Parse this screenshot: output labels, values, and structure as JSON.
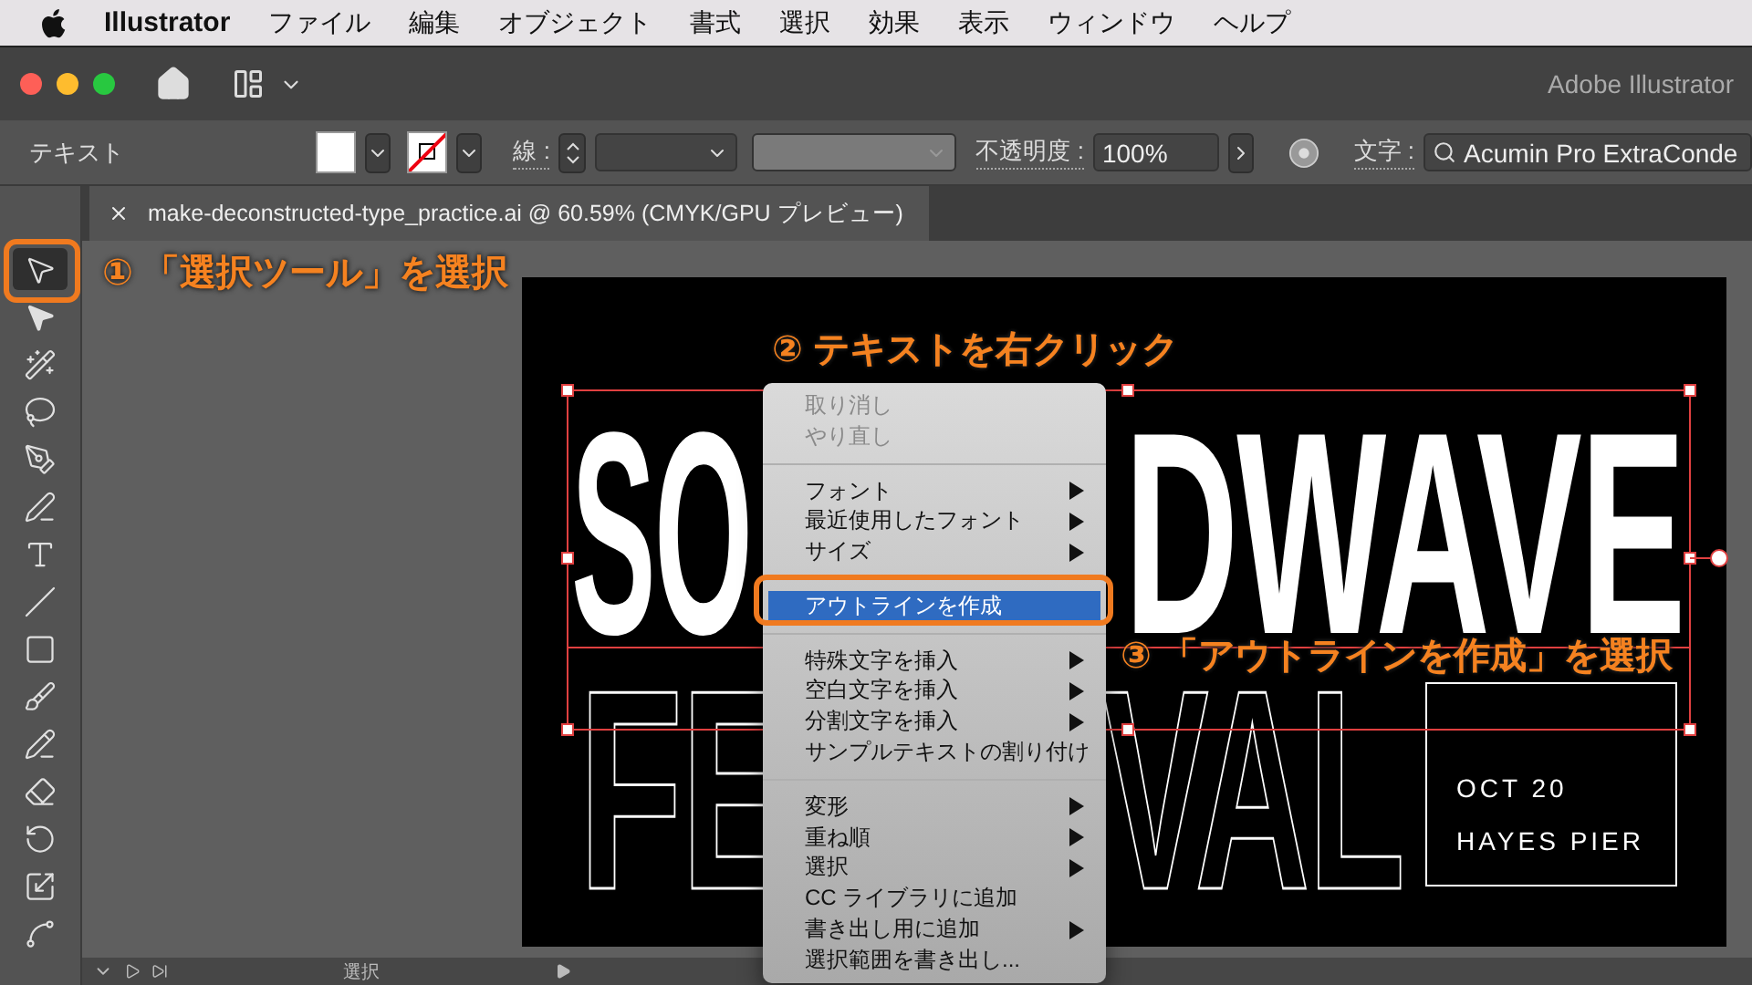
{
  "menu_bar": {
    "app": "Illustrator",
    "items": [
      "ファイル",
      "編集",
      "オブジェクト",
      "書式",
      "選択",
      "効果",
      "表示",
      "ウィンドウ",
      "ヘルプ"
    ]
  },
  "title_bar": {
    "title": "Adobe Illustrator"
  },
  "control_bar": {
    "selection_label": "テキスト",
    "stroke_label": "線 :",
    "opacity_label": "不透明度 :",
    "opacity_value": "100%",
    "character_label": "文字 :",
    "font_value": "Acumin Pro ExtraConde"
  },
  "document_tab": {
    "title": "make-deconstructed-type_practice.ai @ 60.59% (CMYK/GPU プレビュー)"
  },
  "tools": [
    {
      "kind": "selection",
      "selected": true
    },
    {
      "kind": "direct",
      "selected": false
    },
    {
      "kind": "wand",
      "selected": false
    },
    {
      "kind": "lasso",
      "selected": false
    },
    {
      "kind": "pen",
      "selected": false
    },
    {
      "kind": "curvature",
      "selected": false
    },
    {
      "kind": "type",
      "selected": false
    },
    {
      "kind": "line",
      "selected": false
    },
    {
      "kind": "rect",
      "selected": false
    },
    {
      "kind": "brush",
      "selected": false
    },
    {
      "kind": "shaper",
      "selected": false
    },
    {
      "kind": "eraser",
      "selected": false
    },
    {
      "kind": "rotate",
      "selected": false
    },
    {
      "kind": "scale",
      "selected": false
    },
    {
      "kind": "warp",
      "selected": false
    }
  ],
  "artboard": {
    "headline_left": "SO",
    "headline_right": "DWAVE",
    "outline_left": "FE",
    "outline_right": "VAL",
    "info_lines": [
      "OCT 20",
      "HAYES PIER"
    ]
  },
  "context_menu": {
    "groups": [
      [
        {
          "label": "取り消し",
          "disabled": true,
          "submenu": false,
          "selected": false
        },
        {
          "label": "やり直し",
          "disabled": true,
          "submenu": false,
          "selected": false
        }
      ],
      [
        {
          "label": "フォント",
          "disabled": false,
          "submenu": true,
          "selected": false
        },
        {
          "label": "最近使用したフォント",
          "disabled": false,
          "submenu": true,
          "selected": false
        },
        {
          "label": "サイズ",
          "disabled": false,
          "submenu": true,
          "selected": false
        }
      ],
      [
        {
          "label": "アウトラインを作成",
          "disabled": false,
          "submenu": false,
          "selected": true
        }
      ],
      [
        {
          "label": "特殊文字を挿入",
          "disabled": false,
          "submenu": true,
          "selected": false
        },
        {
          "label": "空白文字を挿入",
          "disabled": false,
          "submenu": true,
          "selected": false
        },
        {
          "label": "分割文字を挿入",
          "disabled": false,
          "submenu": true,
          "selected": false
        },
        {
          "label": "サンプルテキストの割り付け",
          "disabled": false,
          "submenu": false,
          "selected": false
        }
      ],
      [
        {
          "label": "変形",
          "disabled": false,
          "submenu": true,
          "selected": false
        },
        {
          "label": "重ね順",
          "disabled": false,
          "submenu": true,
          "selected": false
        },
        {
          "label": "選択",
          "disabled": false,
          "submenu": true,
          "selected": false
        },
        {
          "label": "CC ライブラリに追加",
          "disabled": false,
          "submenu": false,
          "selected": false
        },
        {
          "label": "書き出し用に追加",
          "disabled": false,
          "submenu": true,
          "selected": false
        },
        {
          "label": "選択範囲を書き出し...",
          "disabled": false,
          "submenu": false,
          "selected": false
        }
      ]
    ]
  },
  "status_bar": {
    "tool_name": "選択"
  },
  "annotations": [
    "① 「選択ツール」を選択",
    "② テキストを右クリック",
    "③ 「アウトラインを作成」を選択"
  ]
}
